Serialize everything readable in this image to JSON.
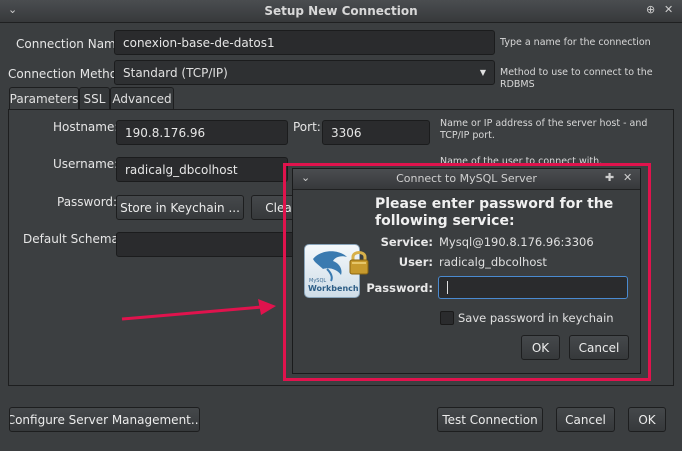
{
  "window": {
    "title": "Setup New Connection"
  },
  "form": {
    "connection_name_label": "Connection Name:",
    "connection_name_value": "conexion-base-de-datos1",
    "connection_name_hint": "Type a name for the connection",
    "connection_method_label": "Connection Method:",
    "connection_method_value": "Standard (TCP/IP)",
    "connection_method_hint": "Method to use to connect to the RDBMS"
  },
  "tabs": [
    {
      "label": "Parameters"
    },
    {
      "label": "SSL"
    },
    {
      "label": "Advanced"
    }
  ],
  "params": {
    "hostname_label": "Hostname:",
    "hostname_value": "190.8.176.96",
    "port_label": "Port:",
    "port_value": "3306",
    "hostname_hint": "Name or IP address of the server host - and TCP/IP port.",
    "username_label": "Username:",
    "username_value": "radicalg_dbcolhost",
    "username_hint": "Name of the user to connect with.",
    "password_label": "Password:",
    "store_keychain_label": "Store in Keychain ...",
    "clear_label": "Clear",
    "default_schema_label": "Default Schema:",
    "default_schema_value": ""
  },
  "footer": {
    "configure_label": "Configure Server Management...",
    "test_label": "Test Connection",
    "cancel_label": "Cancel",
    "ok_label": "OK"
  },
  "dialog": {
    "title": "Connect to MySQL Server",
    "heading": "Please enter password for the following service:",
    "service_label": "Service:",
    "service_value": "Mysql@190.8.176.96:3306",
    "user_label": "User:",
    "user_value": "radicalg_dbcolhost",
    "password_label": "Password:",
    "password_value": "",
    "save_label": "Save password in keychain",
    "ok_label": "OK",
    "cancel_label": "Cancel",
    "logo_small_text": "MySQL",
    "logo_text": "Workbench"
  },
  "colors": {
    "highlight": "#e0134d",
    "background": "#3b3e40"
  }
}
